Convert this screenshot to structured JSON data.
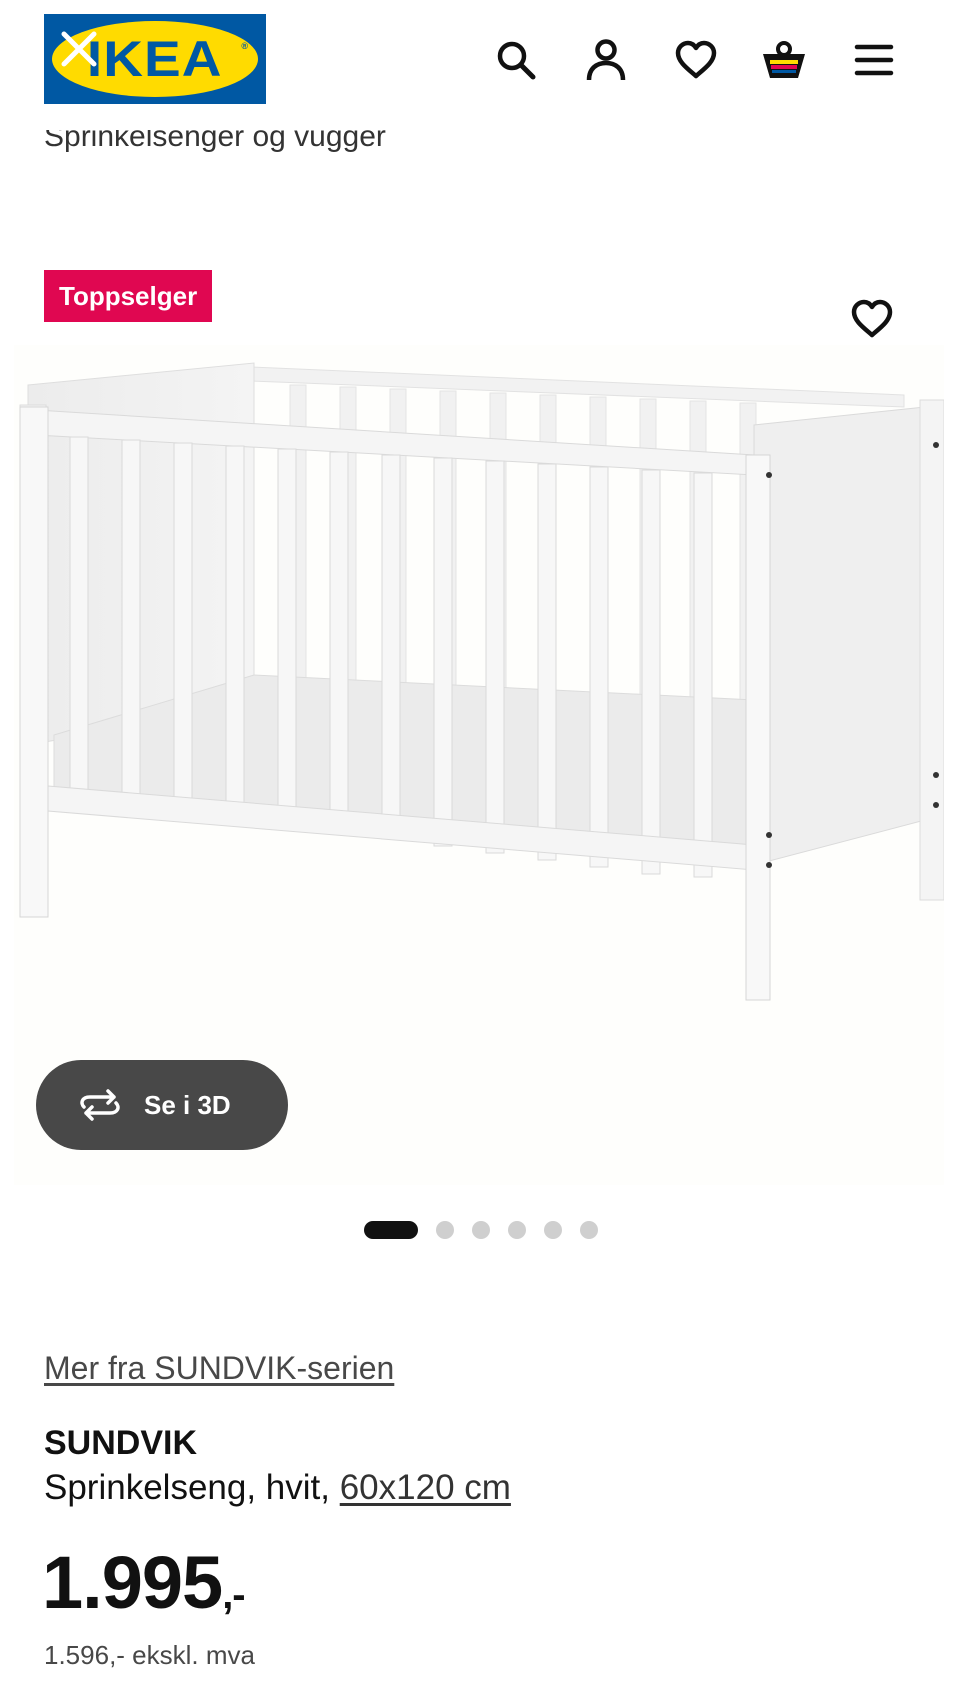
{
  "header": {
    "brand": "IKEA",
    "icons": [
      "close-icon",
      "search-icon",
      "user-icon",
      "heart-icon",
      "shopping-bag-icon",
      "menu-icon"
    ]
  },
  "breadcrumb": "Sprinkelsenger og vugger",
  "badge": "Toppselger",
  "media": {
    "view_3d_label": "Se i 3D",
    "image_count": 6,
    "active_image": 1
  },
  "product": {
    "series_link": "Mer fra SUNDVIK-serien",
    "name": "SUNDVIK",
    "description": "Sprinkelseng, hvit, ",
    "size_link": "60x120 cm",
    "price_main": "1.995",
    "price_suffix": ",-",
    "price_ex_vat": "1.596,- ekskl. mva"
  },
  "colors": {
    "ikea_blue": "#0058a3",
    "ikea_yellow": "#ffdb00",
    "badge_red": "#e00751",
    "button_dark": "#484848"
  }
}
